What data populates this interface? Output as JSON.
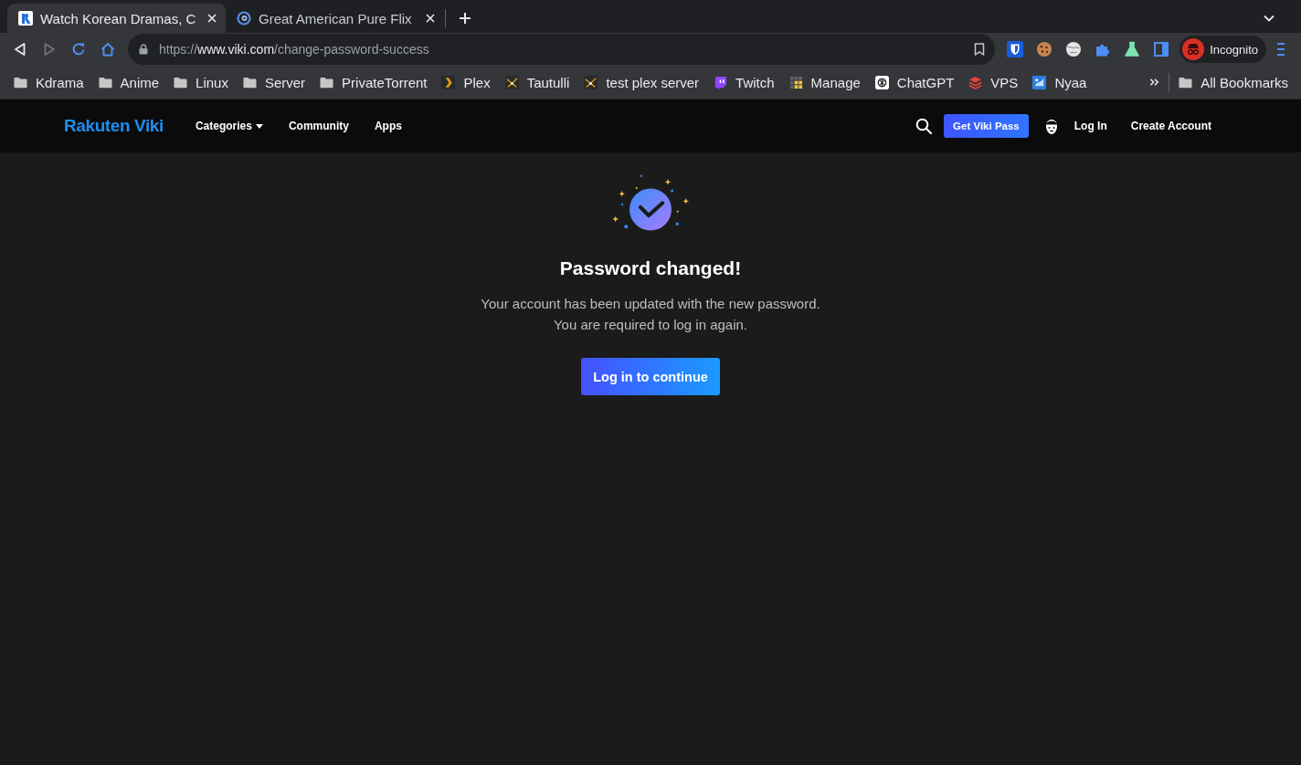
{
  "browser": {
    "tabs": [
      {
        "title": "Watch Korean Dramas, C",
        "selected": true
      },
      {
        "title": "Great American Pure Flix",
        "selected": false
      }
    ],
    "nav_buttons": [
      {
        "kind": "back",
        "disabled": false
      },
      {
        "kind": "forward",
        "disabled": true
      },
      {
        "kind": "reload",
        "disabled": false
      },
      {
        "kind": "home",
        "disabled": false
      }
    ],
    "address": {
      "scheme": "https://",
      "host": "www.viki.com",
      "path": "/change-password-success"
    },
    "profile": {
      "label": "Incognito"
    },
    "bookmarks": [
      {
        "kind": "folder",
        "label": "Kdrama"
      },
      {
        "kind": "folder",
        "label": "Anime"
      },
      {
        "kind": "folder",
        "label": "Linux"
      },
      {
        "kind": "folder",
        "label": "Server"
      },
      {
        "kind": "folder",
        "label": "PrivateTorrent"
      },
      {
        "kind": "site",
        "label": "Plex"
      },
      {
        "kind": "site",
        "label": "Tautulli"
      },
      {
        "kind": "site",
        "label": "test plex server"
      },
      {
        "kind": "site",
        "label": "Twitch"
      },
      {
        "kind": "site",
        "label": "Manage"
      },
      {
        "kind": "site",
        "label": "ChatGPT"
      },
      {
        "kind": "site",
        "label": "VPS"
      },
      {
        "kind": "site",
        "label": "Nyaa"
      }
    ],
    "all_bookmarks": {
      "label": "All Bookmarks"
    }
  },
  "site": {
    "logo": "Rakuten Viki",
    "nav": [
      {
        "label": "Categories",
        "dropdown": true
      },
      {
        "label": "Community",
        "dropdown": false
      },
      {
        "label": "Apps",
        "dropdown": false
      }
    ],
    "pass_button": "Get Viki Pass",
    "login": "Log In",
    "create_account": "Create Account"
  },
  "content": {
    "title": "Password changed!",
    "message": [
      "Your account has been updated with the new password.",
      "You are required to log in again."
    ],
    "button": "Log in to continue"
  }
}
